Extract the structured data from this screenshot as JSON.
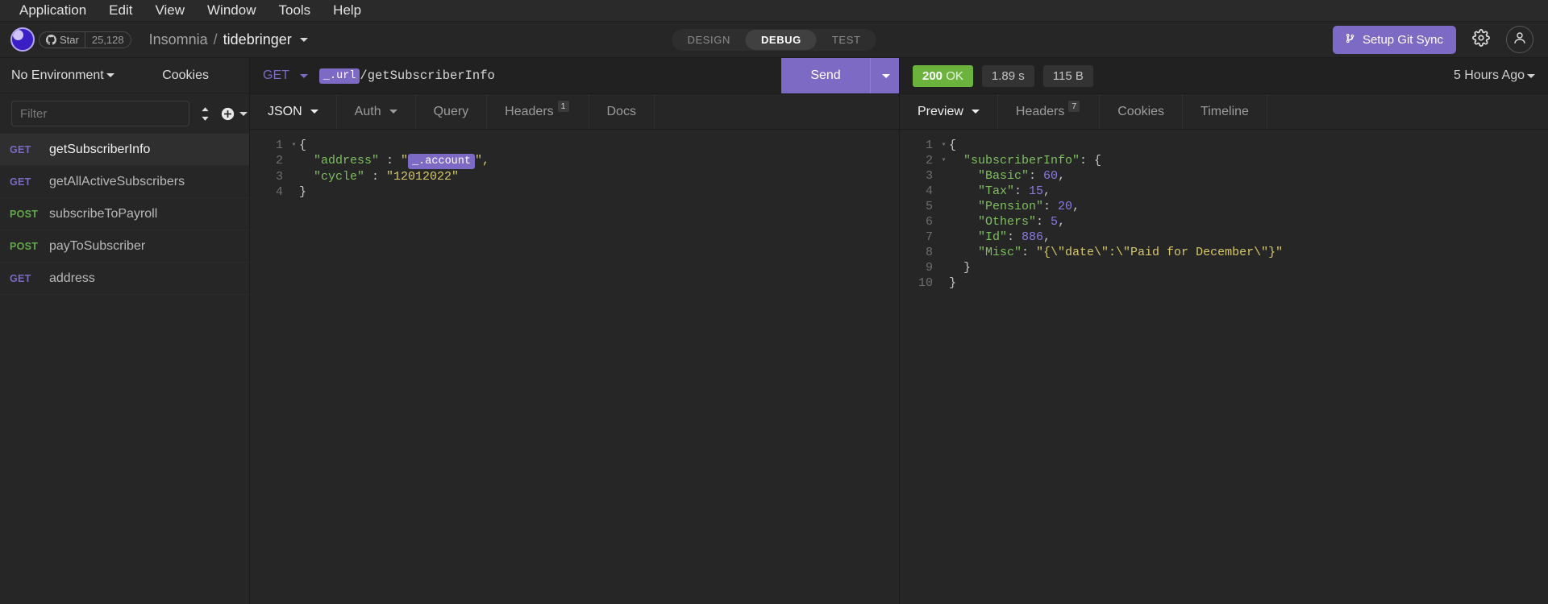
{
  "menubar": {
    "items": [
      "Application",
      "Edit",
      "View",
      "Window",
      "Tools",
      "Help"
    ]
  },
  "header": {
    "logo_name": "insomnia-logo",
    "github_star": {
      "label": "Star",
      "count": "25,128"
    },
    "breadcrumb": {
      "app": "Insomnia",
      "separator": "/",
      "workspace": "tidebringer"
    },
    "segmented": {
      "options": [
        "DESIGN",
        "DEBUG",
        "TEST"
      ],
      "active": "DEBUG"
    },
    "git_sync_label": "Setup Git Sync",
    "settings_icon": "gear-icon",
    "account_icon": "user-icon"
  },
  "sidebar": {
    "environment_label": "No Environment",
    "cookies_label": "Cookies",
    "filter_placeholder": "Filter",
    "filter_value": "",
    "sort_icon": "sort-icon",
    "add_icon": "plus-circle-icon",
    "requests": [
      {
        "method": "GET",
        "name": "getSubscriberInfo",
        "active": true
      },
      {
        "method": "GET",
        "name": "getAllActiveSubscribers",
        "active": false
      },
      {
        "method": "POST",
        "name": "subscribeToPayroll",
        "active": false
      },
      {
        "method": "POST",
        "name": "payToSubscriber",
        "active": false
      },
      {
        "method": "GET",
        "name": "address",
        "active": false
      }
    ]
  },
  "request": {
    "method": "GET",
    "url_tag": "_.url",
    "url_path": "/getSubscriberInfo",
    "send_label": "Send",
    "tabs": [
      {
        "label": "JSON",
        "dropdown": true,
        "badge": "",
        "active": true
      },
      {
        "label": "Auth",
        "dropdown": true,
        "badge": "",
        "active": false
      },
      {
        "label": "Query",
        "dropdown": false,
        "badge": "",
        "active": false
      },
      {
        "label": "Headers",
        "dropdown": false,
        "badge": "1",
        "active": false
      },
      {
        "label": "Docs",
        "dropdown": false,
        "badge": "",
        "active": false
      }
    ],
    "body_lines": [
      {
        "num": "1",
        "fold": true,
        "tokens": [
          {
            "t": "{",
            "c": "p"
          }
        ]
      },
      {
        "num": "2",
        "fold": false,
        "tokens": [
          {
            "t": "  \"address\" ",
            "c": "k"
          },
          {
            "t": ": ",
            "c": "p"
          },
          {
            "t": "\"",
            "c": "s"
          },
          {
            "t": "_.account",
            "c": "tag"
          },
          {
            "t": "\",",
            "c": "s"
          }
        ]
      },
      {
        "num": "3",
        "fold": false,
        "tokens": [
          {
            "t": "  \"cycle\" ",
            "c": "k"
          },
          {
            "t": ": ",
            "c": "p"
          },
          {
            "t": "\"12012022\"",
            "c": "s"
          }
        ]
      },
      {
        "num": "4",
        "fold": false,
        "tokens": [
          {
            "t": "}",
            "c": "p"
          }
        ]
      }
    ]
  },
  "response": {
    "status_code": "200",
    "status_text": "OK",
    "elapsed": "1.89 s",
    "size": "115 B",
    "time_ago": "5 Hours Ago",
    "tabs": [
      {
        "label": "Preview",
        "dropdown": true,
        "badge": "",
        "active": true
      },
      {
        "label": "Headers",
        "dropdown": false,
        "badge": "7",
        "active": false
      },
      {
        "label": "Cookies",
        "dropdown": false,
        "badge": "",
        "active": false
      },
      {
        "label": "Timeline",
        "dropdown": false,
        "badge": "",
        "active": false
      }
    ],
    "body_lines": [
      {
        "num": "1",
        "fold": true,
        "tokens": [
          {
            "t": "{",
            "c": "p"
          }
        ]
      },
      {
        "num": "2",
        "fold": true,
        "tokens": [
          {
            "t": "  \"subscriberInfo\"",
            "c": "k"
          },
          {
            "t": ": {",
            "c": "p"
          }
        ]
      },
      {
        "num": "3",
        "fold": false,
        "tokens": [
          {
            "t": "    \"Basic\"",
            "c": "k"
          },
          {
            "t": ": ",
            "c": "p"
          },
          {
            "t": "60",
            "c": "n"
          },
          {
            "t": ",",
            "c": "p"
          }
        ]
      },
      {
        "num": "4",
        "fold": false,
        "tokens": [
          {
            "t": "    \"Tax\"",
            "c": "k"
          },
          {
            "t": ": ",
            "c": "p"
          },
          {
            "t": "15",
            "c": "n"
          },
          {
            "t": ",",
            "c": "p"
          }
        ]
      },
      {
        "num": "5",
        "fold": false,
        "tokens": [
          {
            "t": "    \"Pension\"",
            "c": "k"
          },
          {
            "t": ": ",
            "c": "p"
          },
          {
            "t": "20",
            "c": "n"
          },
          {
            "t": ",",
            "c": "p"
          }
        ]
      },
      {
        "num": "6",
        "fold": false,
        "tokens": [
          {
            "t": "    \"Others\"",
            "c": "k"
          },
          {
            "t": ": ",
            "c": "p"
          },
          {
            "t": "5",
            "c": "n"
          },
          {
            "t": ",",
            "c": "p"
          }
        ]
      },
      {
        "num": "7",
        "fold": false,
        "tokens": [
          {
            "t": "    \"Id\"",
            "c": "k"
          },
          {
            "t": ": ",
            "c": "p"
          },
          {
            "t": "886",
            "c": "n"
          },
          {
            "t": ",",
            "c": "p"
          }
        ]
      },
      {
        "num": "8",
        "fold": false,
        "tokens": [
          {
            "t": "    \"Misc\"",
            "c": "k"
          },
          {
            "t": ": ",
            "c": "p"
          },
          {
            "t": "\"{\\\"date\\\":\\\"Paid for December\\\"}\"",
            "c": "s"
          }
        ]
      },
      {
        "num": "9",
        "fold": false,
        "tokens": [
          {
            "t": "  }",
            "c": "p"
          }
        ]
      },
      {
        "num": "10",
        "fold": false,
        "tokens": [
          {
            "t": "}",
            "c": "p"
          }
        ]
      }
    ]
  },
  "colors": {
    "accent_purple": "#7d6ac4",
    "status_green": "#6cb33e",
    "method_get": "#7d6ac4",
    "method_post": "#63a84b",
    "background": "#262626"
  }
}
